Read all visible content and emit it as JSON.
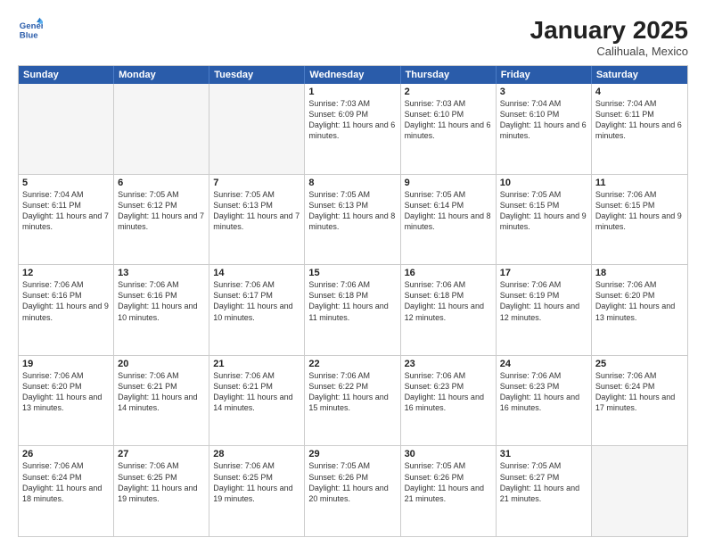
{
  "logo": {
    "line1": "General",
    "line2": "Blue"
  },
  "header": {
    "month_year": "January 2025",
    "location": "Calihuala, Mexico"
  },
  "day_headers": [
    "Sunday",
    "Monday",
    "Tuesday",
    "Wednesday",
    "Thursday",
    "Friday",
    "Saturday"
  ],
  "weeks": [
    {
      "days": [
        {
          "num": "",
          "empty": true
        },
        {
          "num": "",
          "empty": true
        },
        {
          "num": "",
          "empty": true
        },
        {
          "num": "1",
          "sunrise": "7:03 AM",
          "sunset": "6:09 PM",
          "daylight": "11 hours and 6 minutes."
        },
        {
          "num": "2",
          "sunrise": "7:03 AM",
          "sunset": "6:10 PM",
          "daylight": "11 hours and 6 minutes."
        },
        {
          "num": "3",
          "sunrise": "7:04 AM",
          "sunset": "6:10 PM",
          "daylight": "11 hours and 6 minutes."
        },
        {
          "num": "4",
          "sunrise": "7:04 AM",
          "sunset": "6:11 PM",
          "daylight": "11 hours and 6 minutes."
        }
      ]
    },
    {
      "days": [
        {
          "num": "5",
          "sunrise": "7:04 AM",
          "sunset": "6:11 PM",
          "daylight": "11 hours and 7 minutes."
        },
        {
          "num": "6",
          "sunrise": "7:05 AM",
          "sunset": "6:12 PM",
          "daylight": "11 hours and 7 minutes."
        },
        {
          "num": "7",
          "sunrise": "7:05 AM",
          "sunset": "6:13 PM",
          "daylight": "11 hours and 7 minutes."
        },
        {
          "num": "8",
          "sunrise": "7:05 AM",
          "sunset": "6:13 PM",
          "daylight": "11 hours and 8 minutes."
        },
        {
          "num": "9",
          "sunrise": "7:05 AM",
          "sunset": "6:14 PM",
          "daylight": "11 hours and 8 minutes."
        },
        {
          "num": "10",
          "sunrise": "7:05 AM",
          "sunset": "6:15 PM",
          "daylight": "11 hours and 9 minutes."
        },
        {
          "num": "11",
          "sunrise": "7:06 AM",
          "sunset": "6:15 PM",
          "daylight": "11 hours and 9 minutes."
        }
      ]
    },
    {
      "days": [
        {
          "num": "12",
          "sunrise": "7:06 AM",
          "sunset": "6:16 PM",
          "daylight": "11 hours and 9 minutes."
        },
        {
          "num": "13",
          "sunrise": "7:06 AM",
          "sunset": "6:16 PM",
          "daylight": "11 hours and 10 minutes."
        },
        {
          "num": "14",
          "sunrise": "7:06 AM",
          "sunset": "6:17 PM",
          "daylight": "11 hours and 10 minutes."
        },
        {
          "num": "15",
          "sunrise": "7:06 AM",
          "sunset": "6:18 PM",
          "daylight": "11 hours and 11 minutes."
        },
        {
          "num": "16",
          "sunrise": "7:06 AM",
          "sunset": "6:18 PM",
          "daylight": "11 hours and 12 minutes."
        },
        {
          "num": "17",
          "sunrise": "7:06 AM",
          "sunset": "6:19 PM",
          "daylight": "11 hours and 12 minutes."
        },
        {
          "num": "18",
          "sunrise": "7:06 AM",
          "sunset": "6:20 PM",
          "daylight": "11 hours and 13 minutes."
        }
      ]
    },
    {
      "days": [
        {
          "num": "19",
          "sunrise": "7:06 AM",
          "sunset": "6:20 PM",
          "daylight": "11 hours and 13 minutes."
        },
        {
          "num": "20",
          "sunrise": "7:06 AM",
          "sunset": "6:21 PM",
          "daylight": "11 hours and 14 minutes."
        },
        {
          "num": "21",
          "sunrise": "7:06 AM",
          "sunset": "6:21 PM",
          "daylight": "11 hours and 14 minutes."
        },
        {
          "num": "22",
          "sunrise": "7:06 AM",
          "sunset": "6:22 PM",
          "daylight": "11 hours and 15 minutes."
        },
        {
          "num": "23",
          "sunrise": "7:06 AM",
          "sunset": "6:23 PM",
          "daylight": "11 hours and 16 minutes."
        },
        {
          "num": "24",
          "sunrise": "7:06 AM",
          "sunset": "6:23 PM",
          "daylight": "11 hours and 16 minutes."
        },
        {
          "num": "25",
          "sunrise": "7:06 AM",
          "sunset": "6:24 PM",
          "daylight": "11 hours and 17 minutes."
        }
      ]
    },
    {
      "days": [
        {
          "num": "26",
          "sunrise": "7:06 AM",
          "sunset": "6:24 PM",
          "daylight": "11 hours and 18 minutes."
        },
        {
          "num": "27",
          "sunrise": "7:06 AM",
          "sunset": "6:25 PM",
          "daylight": "11 hours and 19 minutes."
        },
        {
          "num": "28",
          "sunrise": "7:06 AM",
          "sunset": "6:25 PM",
          "daylight": "11 hours and 19 minutes."
        },
        {
          "num": "29",
          "sunrise": "7:05 AM",
          "sunset": "6:26 PM",
          "daylight": "11 hours and 20 minutes."
        },
        {
          "num": "30",
          "sunrise": "7:05 AM",
          "sunset": "6:26 PM",
          "daylight": "11 hours and 21 minutes."
        },
        {
          "num": "31",
          "sunrise": "7:05 AM",
          "sunset": "6:27 PM",
          "daylight": "11 hours and 21 minutes."
        },
        {
          "num": "",
          "empty": true
        }
      ]
    }
  ],
  "labels": {
    "sunrise": "Sunrise:",
    "sunset": "Sunset:",
    "daylight": "Daylight:"
  }
}
